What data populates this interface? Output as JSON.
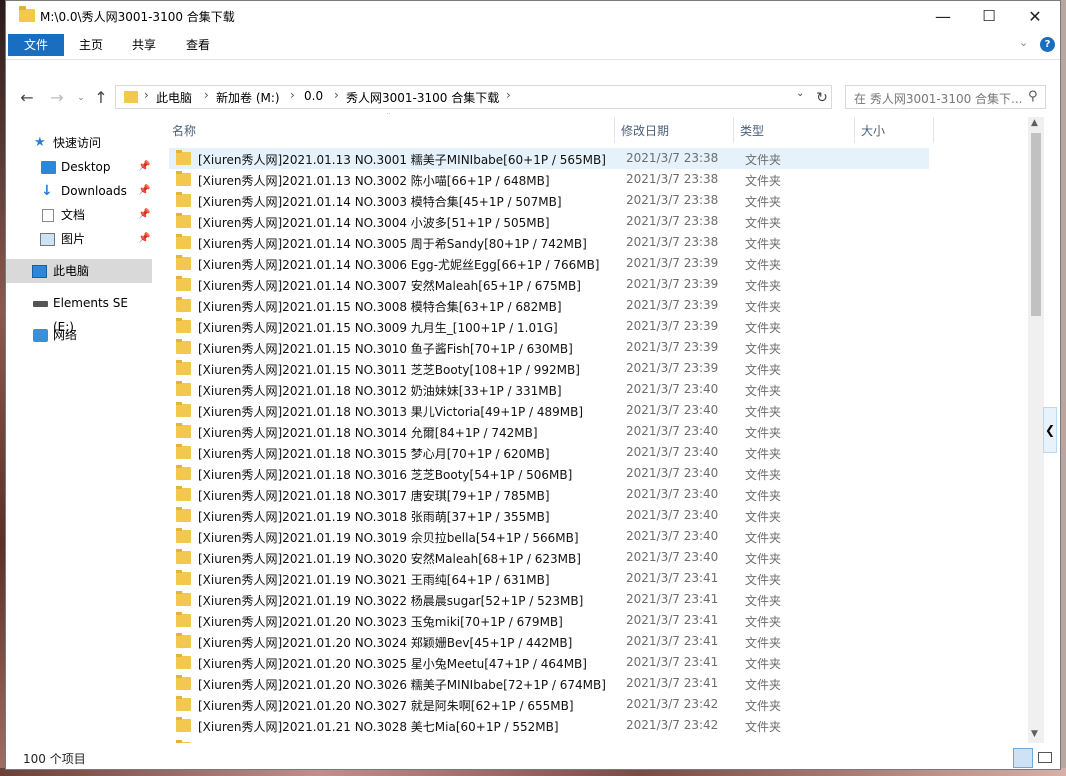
{
  "window": {
    "title": "M:\\0.0\\秀人网3001-3100 合集下载",
    "minimize": "—",
    "maximize": "☐",
    "close": "✕"
  },
  "ribbon": {
    "tabs": [
      "文件",
      "主页",
      "共享",
      "查看"
    ],
    "help": "?"
  },
  "address": {
    "crumbs": [
      "此电脑",
      "新加卷 (M:)",
      "0.0",
      "秀人网3001-3100 合集下载"
    ],
    "search_placeholder": "在 秀人网3001-3100 合集下..."
  },
  "nav": {
    "quick_access": "快速访问",
    "items": [
      "Desktop",
      "Downloads",
      "文档",
      "图片"
    ],
    "this_pc": "此电脑",
    "drive": "Elements SE (E:)",
    "network": "网络"
  },
  "columns": {
    "name": "名称",
    "date": "修改日期",
    "type": "类型",
    "size": "大小"
  },
  "rows": [
    {
      "name": "[Xiuren秀人网]2021.01.13 NO.3001 糯美子MINIbabe[60+1P / 565MB]",
      "date": "2021/3/7 23:38",
      "type": "文件夹"
    },
    {
      "name": "[Xiuren秀人网]2021.01.13 NO.3002 陈小喵[66+1P / 648MB]",
      "date": "2021/3/7 23:38",
      "type": "文件夹"
    },
    {
      "name": "[Xiuren秀人网]2021.01.14 NO.3003 模特合集[45+1P / 507MB]",
      "date": "2021/3/7 23:38",
      "type": "文件夹"
    },
    {
      "name": "[Xiuren秀人网]2021.01.14 NO.3004 小波多[51+1P / 505MB]",
      "date": "2021/3/7 23:38",
      "type": "文件夹"
    },
    {
      "name": "[Xiuren秀人网]2021.01.14 NO.3005 周于希Sandy[80+1P / 742MB]",
      "date": "2021/3/7 23:38",
      "type": "文件夹"
    },
    {
      "name": "[Xiuren秀人网]2021.01.14 NO.3006 Egg-尤妮丝Egg[66+1P / 766MB]",
      "date": "2021/3/7 23:39",
      "type": "文件夹"
    },
    {
      "name": "[Xiuren秀人网]2021.01.14 NO.3007 安然Maleah[65+1P / 675MB]",
      "date": "2021/3/7 23:39",
      "type": "文件夹"
    },
    {
      "name": "[Xiuren秀人网]2021.01.15 NO.3008 模特合集[63+1P / 682MB]",
      "date": "2021/3/7 23:39",
      "type": "文件夹"
    },
    {
      "name": "[Xiuren秀人网]2021.01.15 NO.3009 九月生_[100+1P / 1.01G]",
      "date": "2021/3/7 23:39",
      "type": "文件夹"
    },
    {
      "name": "[Xiuren秀人网]2021.01.15 NO.3010 鱼子酱Fish[70+1P / 630MB]",
      "date": "2021/3/7 23:39",
      "type": "文件夹"
    },
    {
      "name": "[Xiuren秀人网]2021.01.15 NO.3011 芝芝Booty[108+1P / 992MB]",
      "date": "2021/3/7 23:39",
      "type": "文件夹"
    },
    {
      "name": "[Xiuren秀人网]2021.01.18 NO.3012 奶油妹妹[33+1P / 331MB]",
      "date": "2021/3/7 23:40",
      "type": "文件夹"
    },
    {
      "name": "[Xiuren秀人网]2021.01.18 NO.3013 果儿Victoria[49+1P / 489MB]",
      "date": "2021/3/7 23:40",
      "type": "文件夹"
    },
    {
      "name": "[Xiuren秀人网]2021.01.18 NO.3014 允爾[84+1P / 742MB]",
      "date": "2021/3/7 23:40",
      "type": "文件夹"
    },
    {
      "name": "[Xiuren秀人网]2021.01.18 NO.3015 梦心月[70+1P / 620MB]",
      "date": "2021/3/7 23:40",
      "type": "文件夹"
    },
    {
      "name": "[Xiuren秀人网]2021.01.18 NO.3016 芝芝Booty[54+1P / 506MB]",
      "date": "2021/3/7 23:40",
      "type": "文件夹"
    },
    {
      "name": "[Xiuren秀人网]2021.01.18 NO.3017 唐安琪[79+1P / 785MB]",
      "date": "2021/3/7 23:40",
      "type": "文件夹"
    },
    {
      "name": "[Xiuren秀人网]2021.01.19 NO.3018 张雨萌[37+1P / 355MB]",
      "date": "2021/3/7 23:40",
      "type": "文件夹"
    },
    {
      "name": "[Xiuren秀人网]2021.01.19 NO.3019 佘贝拉bella[54+1P / 566MB]",
      "date": "2021/3/7 23:40",
      "type": "文件夹"
    },
    {
      "name": "[Xiuren秀人网]2021.01.19 NO.3020 安然Maleah[68+1P / 623MB]",
      "date": "2021/3/7 23:40",
      "type": "文件夹"
    },
    {
      "name": "[Xiuren秀人网]2021.01.19 NO.3021 王雨纯[64+1P / 631MB]",
      "date": "2021/3/7 23:41",
      "type": "文件夹"
    },
    {
      "name": "[Xiuren秀人网]2021.01.19 NO.3022 杨晨晨sugar[52+1P / 523MB]",
      "date": "2021/3/7 23:41",
      "type": "文件夹"
    },
    {
      "name": "[Xiuren秀人网]2021.01.20 NO.3023 玉兔miki[70+1P / 679MB]",
      "date": "2021/3/7 23:41",
      "type": "文件夹"
    },
    {
      "name": "[Xiuren秀人网]2021.01.20 NO.3024 郑颖姗Bev[45+1P / 442MB]",
      "date": "2021/3/7 23:41",
      "type": "文件夹"
    },
    {
      "name": "[Xiuren秀人网]2021.01.20 NO.3025 星小兔Meetu[47+1P / 464MB]",
      "date": "2021/3/7 23:41",
      "type": "文件夹"
    },
    {
      "name": "[Xiuren秀人网]2021.01.20 NO.3026 糯美子MINIbabe[72+1P / 674MB]",
      "date": "2021/3/7 23:41",
      "type": "文件夹"
    },
    {
      "name": "[Xiuren秀人网]2021.01.20 NO.3027 就是阿朱啊[62+1P / 655MB]",
      "date": "2021/3/7 23:42",
      "type": "文件夹"
    },
    {
      "name": "[Xiuren秀人网]2021.01.21 NO.3028 美七Mia[60+1P / 552MB]",
      "date": "2021/3/7 23:42",
      "type": "文件夹"
    }
  ],
  "status": {
    "count": "100 个项目"
  },
  "colors": {
    "accent": "#1a6ec0",
    "folder": "#f2c94c",
    "selection": "#e5f1fb"
  }
}
